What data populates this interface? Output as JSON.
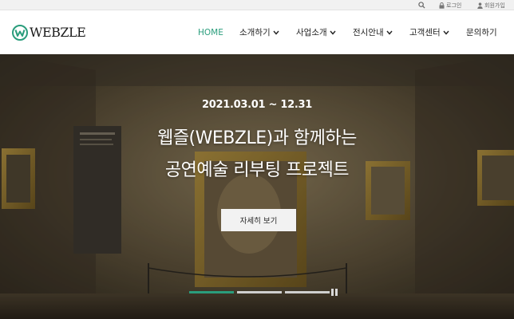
{
  "topbar": {
    "login_label": "로그인",
    "join_label": "회원가입"
  },
  "header": {
    "logo_text": "WEBZLE",
    "nav": [
      {
        "label": "HOME",
        "active": true,
        "dropdown": false
      },
      {
        "label": "소개하기",
        "active": false,
        "dropdown": true
      },
      {
        "label": "사업소개",
        "active": false,
        "dropdown": true
      },
      {
        "label": "전시안내",
        "active": false,
        "dropdown": true
      },
      {
        "label": "고객센터",
        "active": false,
        "dropdown": true
      },
      {
        "label": "문의하기",
        "active": false,
        "dropdown": false
      }
    ]
  },
  "hero": {
    "date": "2021.03.01 ~ 12.31",
    "title_line1": "웹즐(WEBZLE)과 함께하는",
    "title_line2": "공연예술 리부팅 프로젝트",
    "button_label": "자세히 보기",
    "slide_current": 1,
    "slide_total": 3
  },
  "colors": {
    "accent": "#2a9d7c",
    "hero_button_bg": "#f2f2f2"
  }
}
